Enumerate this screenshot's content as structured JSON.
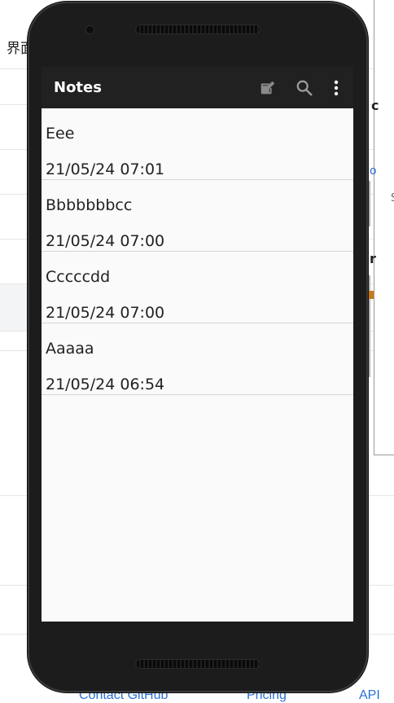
{
  "background": {
    "left_text": "界面",
    "right_fragments": [
      "c",
      "o",
      "r",
      "S"
    ],
    "footer_links": [
      "Contact GitHub",
      "Pricing",
      "API"
    ]
  },
  "app": {
    "title": "Notes",
    "icons": [
      "new-note-icon",
      "search-icon",
      "overflow-menu-icon"
    ]
  },
  "notes": [
    {
      "title": "Eee",
      "date": "21/05/24 07:01"
    },
    {
      "title": "Bbbbbbbcc",
      "date": "21/05/24 07:00"
    },
    {
      "title": "Cccccdd",
      "date": "21/05/24 07:00"
    },
    {
      "title": "Aaaaa",
      "date": "21/05/24 06:54"
    }
  ]
}
